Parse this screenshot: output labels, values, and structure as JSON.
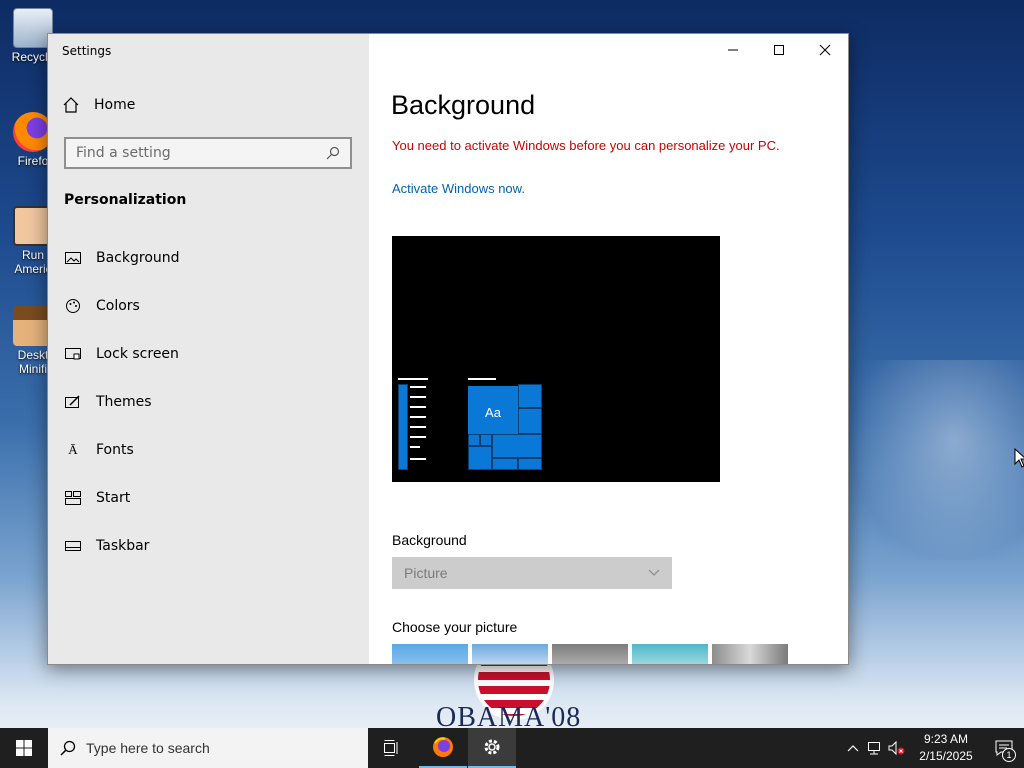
{
  "desktop": {
    "icons": [
      {
        "label": "Recycle",
        "icon": "recycle-bin-icon"
      },
      {
        "label": "Firefo",
        "icon": "firefox-icon"
      },
      {
        "label": "Run Americ",
        "icon": "run-america-icon"
      },
      {
        "label": "Deskt Minifi",
        "icon": "desktop-minifier-icon"
      }
    ],
    "wallpaper_text": "OBAMA'08"
  },
  "window": {
    "title": "Settings",
    "caption": {
      "minimize": "—",
      "maximize": "☐",
      "close": "✕"
    }
  },
  "sidebar": {
    "home_label": "Home",
    "search_placeholder": "Find a setting",
    "section": "Personalization",
    "items": [
      {
        "label": "Background",
        "icon": "picture-icon"
      },
      {
        "label": "Colors",
        "icon": "palette-icon"
      },
      {
        "label": "Lock screen",
        "icon": "lock-screen-icon"
      },
      {
        "label": "Themes",
        "icon": "themes-brush-icon"
      },
      {
        "label": "Fonts",
        "icon": "fonts-icon"
      },
      {
        "label": "Start",
        "icon": "start-layout-icon"
      },
      {
        "label": "Taskbar",
        "icon": "taskbar-icon"
      }
    ]
  },
  "main": {
    "title": "Background",
    "warning": "You need to activate Windows before you can personalize your PC.",
    "activate_link": "Activate Windows now.",
    "preview_tile_text": "Aa",
    "background_label": "Background",
    "background_value": "Picture",
    "choose_label": "Choose your picture"
  },
  "taskbar": {
    "search_placeholder": "Type here to search",
    "time": "9:23 AM",
    "date": "2/15/2025",
    "notification_count": "1"
  },
  "colors": {
    "accent": "#0078d7",
    "warning": "#c50500",
    "link": "#0063b1"
  }
}
